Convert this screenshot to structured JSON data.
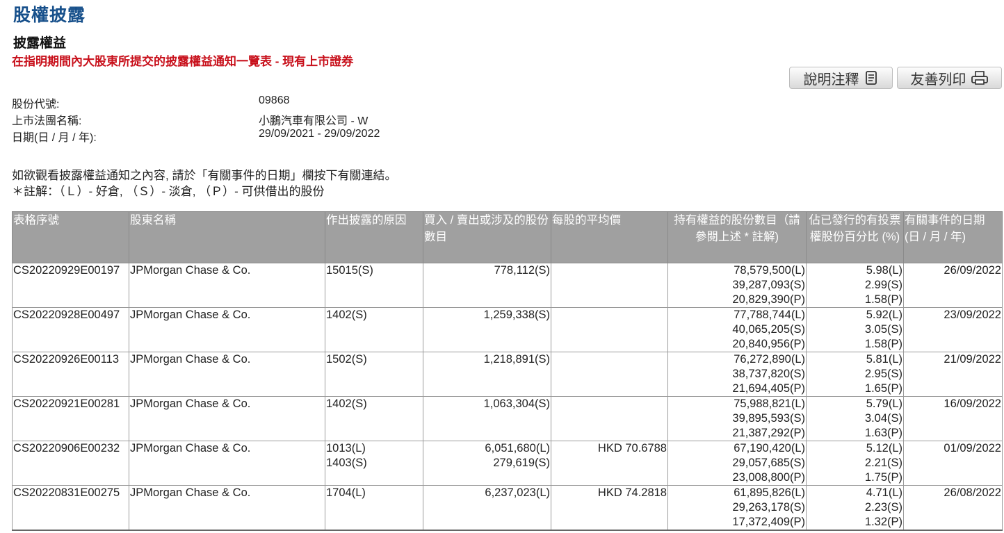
{
  "page": {
    "title": "股權披露",
    "subtitle": "披露權益",
    "heading": "在指明期間內大股東所提交的披露權益通知一覽表 - 現有上市證券"
  },
  "buttons": {
    "notes_label": "說明注釋",
    "print_label": "友善列印"
  },
  "info": {
    "code_label": "股份代號:",
    "code_value": "09868",
    "name_label": "上市法團名稱:",
    "name_value": "小鵬汽車有限公司 - W",
    "date_label": "日期(日 / 月 / 年):",
    "date_value": "29/09/2021 - 29/09/2022"
  },
  "instructions": {
    "line1": "如欲觀看披露權益通知之內容, 請於「有關事件的日期」欄按下有關連結。",
    "line2": "＊註解：（Ｌ）- 好倉, （Ｓ）- 淡倉, （Ｐ）- 可供借出的股份"
  },
  "table": {
    "headers": [
      "表格序號",
      "股東名稱",
      "作出披露的原因",
      "買入 / 賣出或涉及的股份數目",
      "每股的平均價",
      "持有權益的股份數目（請參閱上述 * 註解)",
      "佔已發行的有投票權股份百分比 (%)",
      "有關事件的日期 (日 / 月 / 年)"
    ],
    "rows": [
      {
        "form_no": "CS20220929E00197",
        "holder": "JPMorgan Chase & Co.",
        "reason": [
          "15015(S)"
        ],
        "shares_involved": [
          "778,112(S)"
        ],
        "avg_price": "",
        "shares_held": [
          "78,579,500(L)",
          "39,287,093(S)",
          "20,829,390(P)"
        ],
        "percent": [
          "5.98(L)",
          "2.99(S)",
          "1.58(P)"
        ],
        "event_date": "26/09/2022"
      },
      {
        "form_no": "CS20220928E00497",
        "holder": "JPMorgan Chase & Co.",
        "reason": [
          "1402(S)"
        ],
        "shares_involved": [
          "1,259,338(S)"
        ],
        "avg_price": "",
        "shares_held": [
          "77,788,744(L)",
          "40,065,205(S)",
          "20,840,956(P)"
        ],
        "percent": [
          "5.92(L)",
          "3.05(S)",
          "1.58(P)"
        ],
        "event_date": "23/09/2022"
      },
      {
        "form_no": "CS20220926E00113",
        "holder": "JPMorgan Chase & Co.",
        "reason": [
          "1502(S)"
        ],
        "shares_involved": [
          "1,218,891(S)"
        ],
        "avg_price": "",
        "shares_held": [
          "76,272,890(L)",
          "38,737,820(S)",
          "21,694,405(P)"
        ],
        "percent": [
          "5.81(L)",
          "2.95(S)",
          "1.65(P)"
        ],
        "event_date": "21/09/2022"
      },
      {
        "form_no": "CS20220921E00281",
        "holder": "JPMorgan Chase & Co.",
        "reason": [
          "1402(S)"
        ],
        "shares_involved": [
          "1,063,304(S)"
        ],
        "avg_price": "",
        "shares_held": [
          "75,988,821(L)",
          "39,895,593(S)",
          "21,387,292(P)"
        ],
        "percent": [
          "5.79(L)",
          "3.04(S)",
          "1.63(P)"
        ],
        "event_date": "16/09/2022"
      },
      {
        "form_no": "CS20220906E00232",
        "holder": "JPMorgan Chase & Co.",
        "reason": [
          "1013(L)",
          "1403(S)"
        ],
        "shares_involved": [
          "6,051,680(L)",
          "279,619(S)"
        ],
        "avg_price": "HKD 70.6788",
        "shares_held": [
          "67,190,420(L)",
          "29,057,685(S)",
          "23,008,800(P)"
        ],
        "percent": [
          "5.12(L)",
          "2.21(S)",
          "1.75(P)"
        ],
        "event_date": "01/09/2022"
      },
      {
        "form_no": "CS20220831E00275",
        "holder": "JPMorgan Chase & Co.",
        "reason": [
          "1704(L)"
        ],
        "shares_involved": [
          "6,237,023(L)"
        ],
        "avg_price": "HKD 74.2818",
        "shares_held": [
          "61,895,826(L)",
          "29,263,178(S)",
          "17,372,409(P)"
        ],
        "percent": [
          "4.71(L)",
          "2.23(S)",
          "1.32(P)"
        ],
        "event_date": "26/08/2022"
      }
    ]
  }
}
